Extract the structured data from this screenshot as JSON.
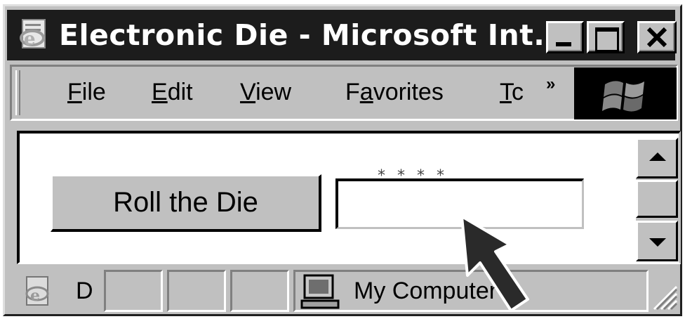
{
  "window": {
    "title": "Electronic Die - Microsoft Int...",
    "controls": {
      "minimize_icon": "minimize-icon",
      "maximize_icon": "maximize-icon",
      "close_icon": "close-icon"
    }
  },
  "menubar": {
    "items": [
      {
        "accel": "F",
        "rest": "ile"
      },
      {
        "accel": "E",
        "rest": "dit"
      },
      {
        "accel": "V",
        "rest": "iew"
      },
      {
        "pre": "F",
        "accel": "a",
        "rest": "vorites"
      },
      {
        "accel": "T",
        "rest": "c"
      }
    ],
    "overflow": "»"
  },
  "content": {
    "roll_button_label": "Roll the Die",
    "die_marks": "* * * *",
    "die_value": ""
  },
  "statusbar": {
    "progress_text": "D",
    "zone_text": "My Computer"
  },
  "colors": {
    "titlebar": "#1c1c1c",
    "chrome": "#c0c0c0",
    "content_bg": "#ffffff"
  }
}
